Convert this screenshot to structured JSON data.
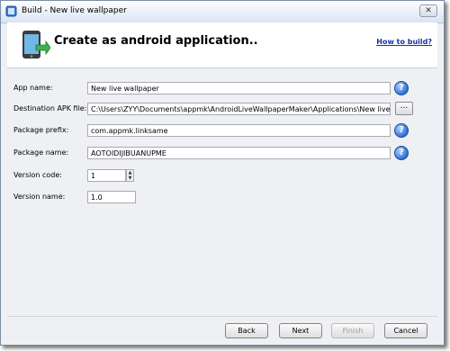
{
  "window": {
    "title": "Build - New live wallpaper"
  },
  "header": {
    "title": "Create as android application..",
    "help_link": "How to build?"
  },
  "form": {
    "app_name": {
      "label": "App name:",
      "value": "New live wallpaper"
    },
    "destination": {
      "label": "Destination APK file:",
      "value": "C:\\Users\\ZYY\\Documents\\appmk\\AndroidLiveWallpaperMaker\\Applications\\New live wallpaper.ap",
      "browse_label": "..."
    },
    "package_prefix": {
      "label": "Package prefix:",
      "value": "com.appmk.linksame"
    },
    "package_name": {
      "label": "Package name:",
      "value": "AOTOIDIJIBUANUPME"
    },
    "version_code": {
      "label": "Version code:",
      "value": "1"
    },
    "version_name": {
      "label": "Version name:",
      "value": "1.0"
    }
  },
  "buttons": {
    "back": "Back",
    "next": "Next",
    "finish": "Finish",
    "cancel": "Cancel"
  }
}
